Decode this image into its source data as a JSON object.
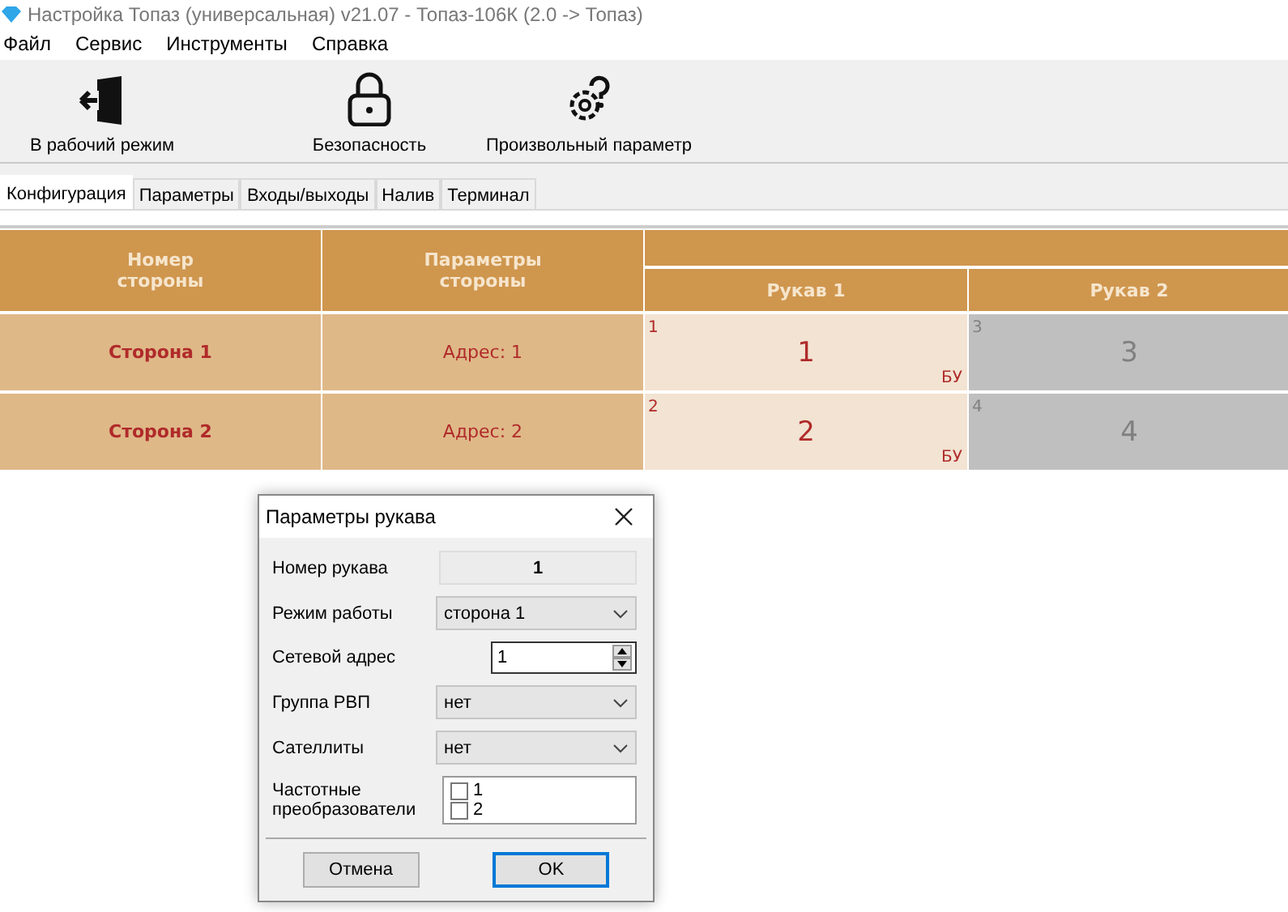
{
  "window": {
    "title": "Настройка Топаз (универсальная) v21.07 - Топаз-106К (2.0 -> Топаз)"
  },
  "menu": [
    "Файл",
    "Сервис",
    "Инструменты",
    "Справка"
  ],
  "toolbar": [
    {
      "label": "В рабочий режим",
      "kind": "exit"
    },
    {
      "label": "Безопасность",
      "kind": "lock"
    },
    {
      "label": "Произвольный параметр",
      "kind": "gear"
    }
  ],
  "tabs": [
    {
      "label": "Конфигурация",
      "selected": true
    },
    {
      "label": "Параметры",
      "selected": false
    },
    {
      "label": "Входы/выходы",
      "selected": false
    },
    {
      "label": "Налив",
      "selected": false
    },
    {
      "label": "Терминал",
      "selected": false
    }
  ],
  "table": {
    "columns": [
      "Номер стороны",
      "Параметры стороны"
    ],
    "sleeve_columns": [
      "Рукав 1",
      "Рукав 2"
    ],
    "rows": [
      {
        "side": "Сторона 1",
        "params": "Адрес: 1",
        "sleeves": [
          {
            "corner": "1",
            "number": "1",
            "tag": "БУ",
            "active": true
          },
          {
            "corner": "3",
            "number": "3",
            "active": false
          }
        ]
      },
      {
        "side": "Сторона 2",
        "params": "Адрес: 2",
        "sleeves": [
          {
            "corner": "2",
            "number": "2",
            "tag": "БУ",
            "active": true
          },
          {
            "corner": "4",
            "number": "4",
            "active": false
          }
        ]
      }
    ]
  },
  "dialog": {
    "title": "Параметры рукава",
    "fields": [
      {
        "kind": "readonly",
        "label": "Номер рукава",
        "value": "1"
      },
      {
        "kind": "select",
        "label": "Режим работы",
        "value": "сторона 1"
      },
      {
        "kind": "spin",
        "label": "Сетевой адрес",
        "value": "1"
      },
      {
        "kind": "select",
        "label": "Группа РВП",
        "value": "нет"
      },
      {
        "kind": "select",
        "label": "Сателлиты",
        "value": "нет"
      },
      {
        "kind": "checklist",
        "label": "Частотные преобразователи",
        "items": [
          {
            "label": "1",
            "checked": false
          },
          {
            "label": "2",
            "checked": false
          }
        ]
      }
    ],
    "buttons": [
      {
        "label": "Отмена",
        "default": false
      },
      {
        "label": "OK",
        "default": true
      }
    ]
  }
}
